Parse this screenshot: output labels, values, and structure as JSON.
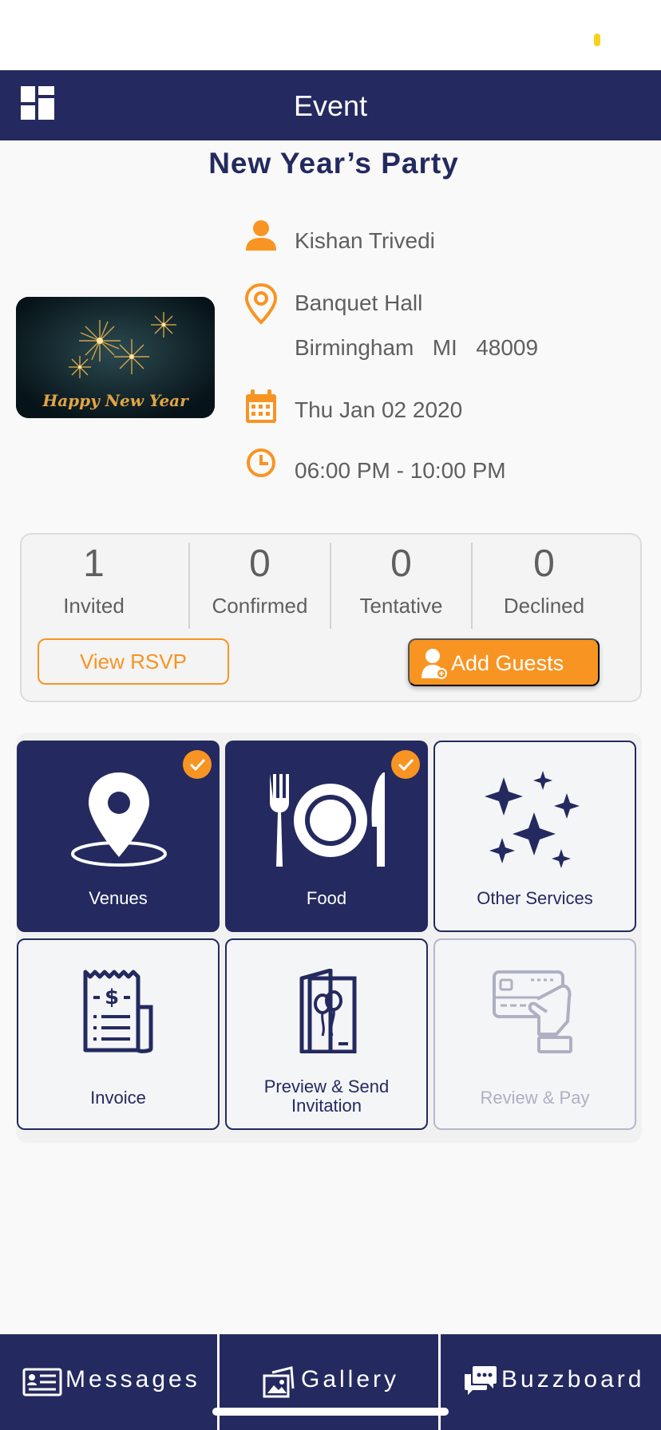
{
  "colors": {
    "navy": "#242a5f",
    "orange": "#f89422",
    "status_dot": "#f5d31a"
  },
  "header": {
    "title": "Event",
    "menu_icon": "dashboard-grid-icon"
  },
  "event": {
    "title": "New Year’s Party",
    "image_caption": "Happy New Year",
    "host": "Kishan Trivedi",
    "venue_name": "Banquet Hall",
    "city": "Birmingham",
    "state": "MI",
    "zip": "48009",
    "date": "Thu Jan 02 2020",
    "time": "06:00 PM - 10:00 PM"
  },
  "stats": [
    {
      "value": "1",
      "label": "Invited"
    },
    {
      "value": "0",
      "label": "Confirmed"
    },
    {
      "value": "0",
      "label": "Tentative"
    },
    {
      "value": "0",
      "label": "Declined"
    }
  ],
  "buttons": {
    "view_rsvp": "View RSVP",
    "add_guests": "Add Guests"
  },
  "tiles": [
    {
      "label": "Venues",
      "icon": "map-pin-icon",
      "completed": true
    },
    {
      "label": "Food",
      "icon": "plate-cutlery-icon",
      "completed": true
    },
    {
      "label": "Other Services",
      "icon": "sparkles-icon",
      "completed": false
    },
    {
      "label": "Invoice",
      "icon": "receipt-icon",
      "completed": false
    },
    {
      "label": "Preview & Send",
      "label2": "Invitation",
      "icon": "invitation-card-icon",
      "completed": false
    },
    {
      "label": "Review & Pay",
      "icon": "credit-card-hand-icon",
      "completed": false,
      "disabled": true
    }
  ],
  "tabbar": {
    "messages": "Messages",
    "gallery": "Gallery",
    "buzzboard": "Buzzboard"
  }
}
